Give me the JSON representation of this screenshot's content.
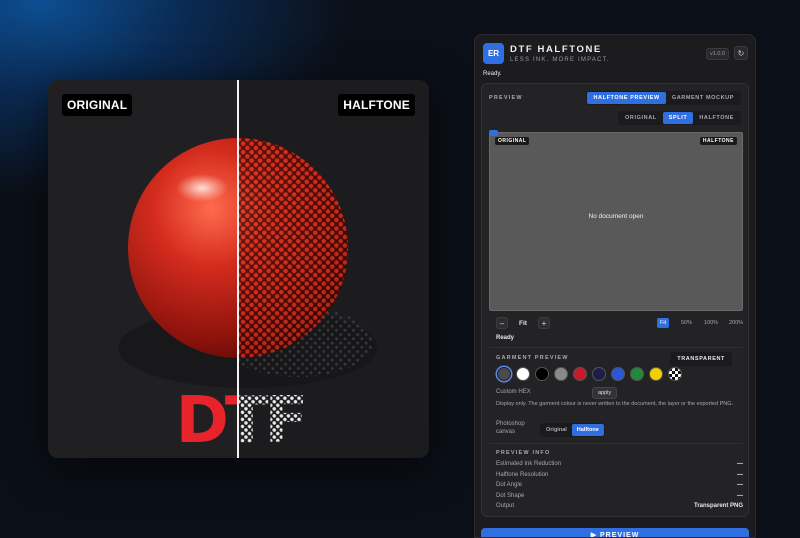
{
  "showcase": {
    "label_left": "ORIGINAL",
    "label_right": "HALFTONE",
    "art_text": "DTF"
  },
  "header": {
    "logo": "ER",
    "title": "DTF HALFTONE",
    "subtitle": "LESS INK. MORE IMPACT.",
    "version": "v1.0.0",
    "refresh_icon": "↻"
  },
  "status_top": "Ready.",
  "preview": {
    "section_title": "PREVIEW",
    "mode_tabs": [
      "HALFTONE PREVIEW",
      "GARMENT MOCKUP"
    ],
    "view_tabs": [
      "ORIGINAL",
      "SPLIT",
      "HALFTONE"
    ],
    "viewport_label_left": "ORIGINAL",
    "viewport_label_right": "HALFTONE",
    "empty_message": "No document open",
    "zoom_minus": "–",
    "zoom_value": "Fit",
    "zoom_plus": "+",
    "zoom_presets": [
      "Fit",
      "50%",
      "100%",
      "200%"
    ],
    "status": "Ready"
  },
  "garment": {
    "section_title": "GARMENT PREVIEW",
    "badge": "TRANSPARENT",
    "swatches": [
      "#4a4a4e",
      "#ffffff",
      "#000000",
      "#8a8a8a",
      "#c8182c",
      "#1d1f4a",
      "#2a57d6",
      "#1f8a3a",
      "#f0d000",
      "transparent"
    ],
    "custom_hex_label": "Custom HEX",
    "apply_label": "apply",
    "note": "Display only. The garment colour is never written to the document, the layer or the exported PNG.",
    "canvas_label": "Photoshop canvas",
    "canvas_options": [
      "Original",
      "Halftone"
    ]
  },
  "info": {
    "section_title": "PREVIEW INFO",
    "rows": [
      {
        "label": "Estimated Ink Reduction",
        "value": "—"
      },
      {
        "label": "Halftone Resolution",
        "value": "—"
      },
      {
        "label": "Dot Angle",
        "value": "—"
      },
      {
        "label": "Dot Shape",
        "value": "—"
      },
      {
        "label": "Output",
        "value": "Transparent PNG"
      }
    ]
  },
  "preview_button": "▶ PREVIEW"
}
